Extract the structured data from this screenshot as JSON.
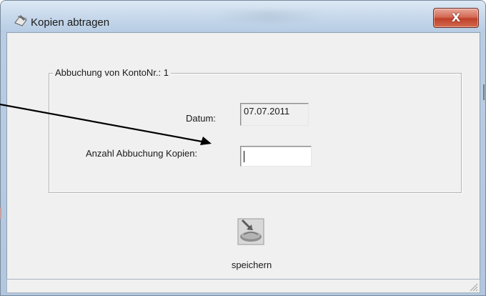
{
  "window": {
    "title": "Kopien abtragen",
    "close_glyph": "X"
  },
  "icons": {
    "title_icon": "edit-document-icon",
    "close_icon": "close-icon",
    "save_icon": "save-data-icon"
  },
  "group": {
    "legend": "Abbuchung von KontoNr.: 1"
  },
  "form": {
    "datum_label": "Datum:",
    "datum_value": "07.07.2011",
    "anzahl_label": "Anzahl Abbuchung Kopien:",
    "anzahl_value": ""
  },
  "buttons": {
    "save_label": "speichern"
  },
  "colors": {
    "close_button": "#c7432d",
    "window_frame": "#b9cde2",
    "client_bg": "#f0f0f0"
  }
}
